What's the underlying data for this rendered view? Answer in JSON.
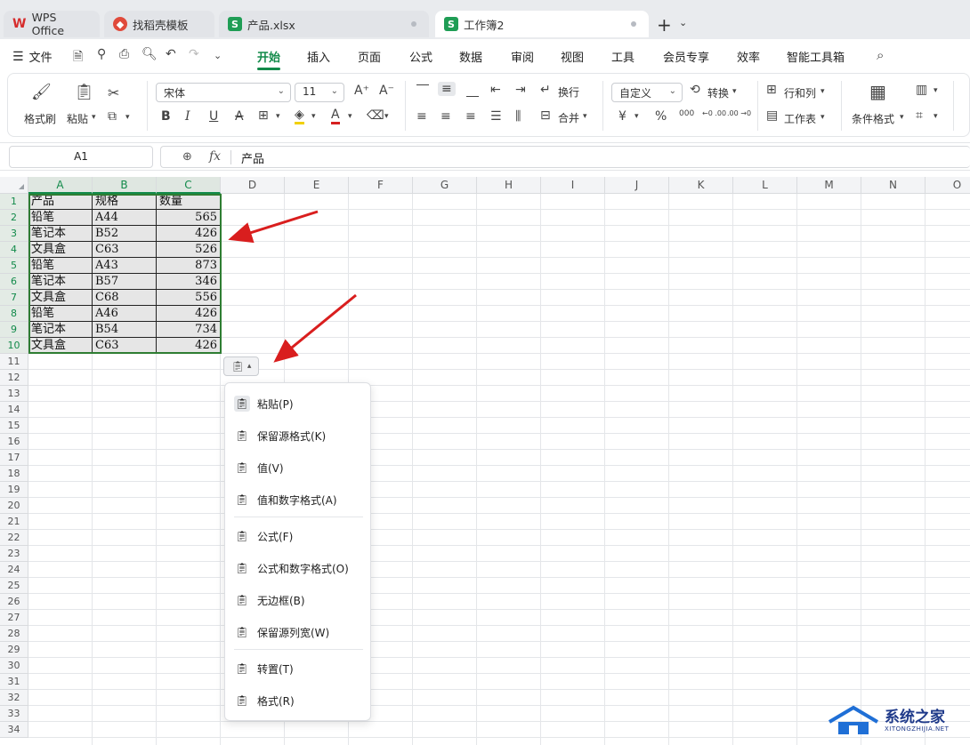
{
  "tabs": [
    {
      "label": "WPS Office",
      "icon": "wps-logo-icon",
      "color": "#d62c2c"
    },
    {
      "label": "找稻壳模板",
      "icon": "docer-icon",
      "color": "#e04a3b"
    },
    {
      "label": "产品.xlsx",
      "icon": "spreadsheet-icon",
      "color": "#1f9d55"
    },
    {
      "label": "工作簿2",
      "icon": "spreadsheet-icon",
      "color": "#1f9d55"
    }
  ],
  "menu": {
    "file": "文件",
    "items": [
      "开始",
      "插入",
      "页面",
      "公式",
      "数据",
      "审阅",
      "视图",
      "工具",
      "会员专享",
      "效率",
      "智能工具箱"
    ],
    "active": "开始"
  },
  "ribbon": {
    "format_painter": "格式刷",
    "paste": "粘贴",
    "font_name": "宋体",
    "font_size": "11",
    "bold": "B",
    "italic": "I",
    "underline": "U",
    "strike": "A",
    "wrap": "换行",
    "merge": "合并",
    "number_format": "自定义",
    "convert": "转换",
    "rows_cols": "行和列",
    "worksheet": "工作表",
    "cond_format": "条件格式",
    "currency": "¥",
    "percent": "%",
    "thousands": "000",
    "dec_inc": "←0 .00",
    "dec_dec": ".00 →0"
  },
  "formula_bar": {
    "cell_ref": "A1",
    "fx": "fx",
    "value": "产品"
  },
  "columns": [
    "A",
    "B",
    "C",
    "D",
    "E",
    "F",
    "G",
    "H",
    "I",
    "J",
    "K",
    "L",
    "M",
    "N",
    "O"
  ],
  "rows": [
    "1",
    "2",
    "3",
    "4",
    "5",
    "6",
    "7",
    "8",
    "9",
    "10",
    "11",
    "12",
    "13",
    "14",
    "15",
    "16",
    "17",
    "18",
    "19",
    "20",
    "21",
    "22",
    "23",
    "24",
    "25",
    "26",
    "27",
    "28",
    "29",
    "30",
    "31",
    "32",
    "33",
    "34"
  ],
  "table": [
    [
      "产品",
      "规格",
      "数量"
    ],
    [
      "铅笔",
      "A44",
      "565"
    ],
    [
      "笔记本",
      "B52",
      "426"
    ],
    [
      "文具盒",
      "C63",
      "526"
    ],
    [
      "铅笔",
      "A43",
      "873"
    ],
    [
      "笔记本",
      "B57",
      "346"
    ],
    [
      "文具盒",
      "C68",
      "556"
    ],
    [
      "铅笔",
      "A46",
      "426"
    ],
    [
      "笔记本",
      "B54",
      "734"
    ],
    [
      "文具盒",
      "C63",
      "426"
    ]
  ],
  "paste_menu": [
    {
      "label": "粘贴(P)",
      "icon": "paste-icon"
    },
    {
      "label": "保留源格式(K)",
      "icon": "paste-keep-format-icon"
    },
    {
      "label": "值(V)",
      "icon": "paste-values-icon"
    },
    {
      "label": "值和数字格式(A)",
      "icon": "paste-values-number-format-icon"
    },
    {
      "label": "公式(F)",
      "icon": "paste-formula-icon"
    },
    {
      "label": "公式和数字格式(O)",
      "icon": "paste-formula-number-format-icon"
    },
    {
      "label": "无边框(B)",
      "icon": "paste-no-border-icon"
    },
    {
      "label": "保留源列宽(W)",
      "icon": "paste-keep-column-width-icon"
    },
    {
      "label": "转置(T)",
      "icon": "paste-transpose-icon"
    },
    {
      "label": "格式(R)",
      "icon": "paste-format-icon"
    }
  ],
  "watermark": {
    "title": "系统之家",
    "subtitle": "XITONGZHIJIA.NET"
  },
  "colors": {
    "accent": "#128a4a",
    "selection": "#2e7d32",
    "arrow": "#d91e1e"
  }
}
